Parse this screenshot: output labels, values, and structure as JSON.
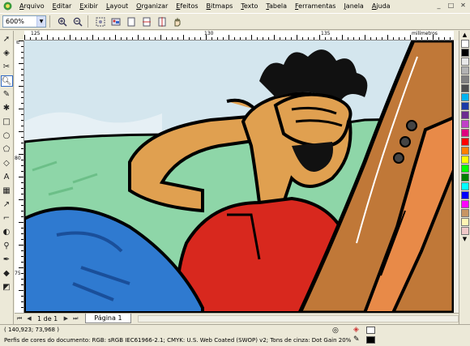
{
  "menu": {
    "items": [
      "Arquivo",
      "Editar",
      "Exibir",
      "Layout",
      "Organizar",
      "Efeitos",
      "Bitmaps",
      "Texto",
      "Tabela",
      "Ferramentas",
      "Janela",
      "Ajuda"
    ],
    "window_buttons": [
      "_",
      "□",
      "✕"
    ]
  },
  "toolbar": {
    "zoom_value": "600%",
    "icons": [
      "zoom-in-icon",
      "zoom-out-icon",
      "zoom-selection-icon",
      "zoom-all-icon",
      "zoom-page-icon",
      "zoom-width-icon",
      "zoom-height-icon",
      "pan-icon"
    ]
  },
  "toolbox": {
    "tools": [
      "pick-tool-icon",
      "shape-tool-icon",
      "crop-tool-icon",
      "zoom-tool-icon",
      "freehand-tool-icon",
      "smart-fill-icon",
      "rectangle-tool-icon",
      "ellipse-tool-icon",
      "polygon-tool-icon",
      "basic-shapes-icon",
      "text-tool-icon",
      "table-tool-icon",
      "dimension-tool-icon",
      "connector-tool-icon",
      "blend-tool-icon",
      "eyedropper-tool-icon",
      "outline-tool-icon",
      "fill-tool-icon",
      "interactive-fill-icon"
    ],
    "active_index": 3
  },
  "rulers": {
    "h_labels": [
      "125",
      "130",
      "135"
    ],
    "v_labels": [
      "80",
      "75"
    ],
    "units": "milímetros"
  },
  "palette": {
    "colors": [
      "#ffffff",
      "#000000",
      "#e8e8e8",
      "#b3b3b3",
      "#808080",
      "#4d4d4d",
      "#00b4ef",
      "#1c3aa8",
      "#6d2c91",
      "#c040c8",
      "#e0007f",
      "#ff0000",
      "#ff8000",
      "#ffff00",
      "#00ff00",
      "#008000",
      "#00ffff",
      "#0000ff",
      "#ff00ff",
      "#c89664",
      "#fff5b4",
      "#f0c8c8"
    ]
  },
  "pagebar": {
    "count": "1 de 1",
    "tab": "Página 1"
  },
  "status": {
    "coords": "( 140,923; 73,968 )",
    "profile": "Perfis de cores do documento: RGB: sRGB IEC61966-2.1; CMYK: U.S. Web Coated (SWOP) v2; Tons de cinza: Dot Gain 20%"
  },
  "colors": {
    "sky": "#d7e8f0",
    "grass": "#8ed6a8",
    "skin": "#e0a050",
    "shirt": "#d8281e",
    "jeans": "#2f7ad0",
    "guitar": "#c07838"
  }
}
